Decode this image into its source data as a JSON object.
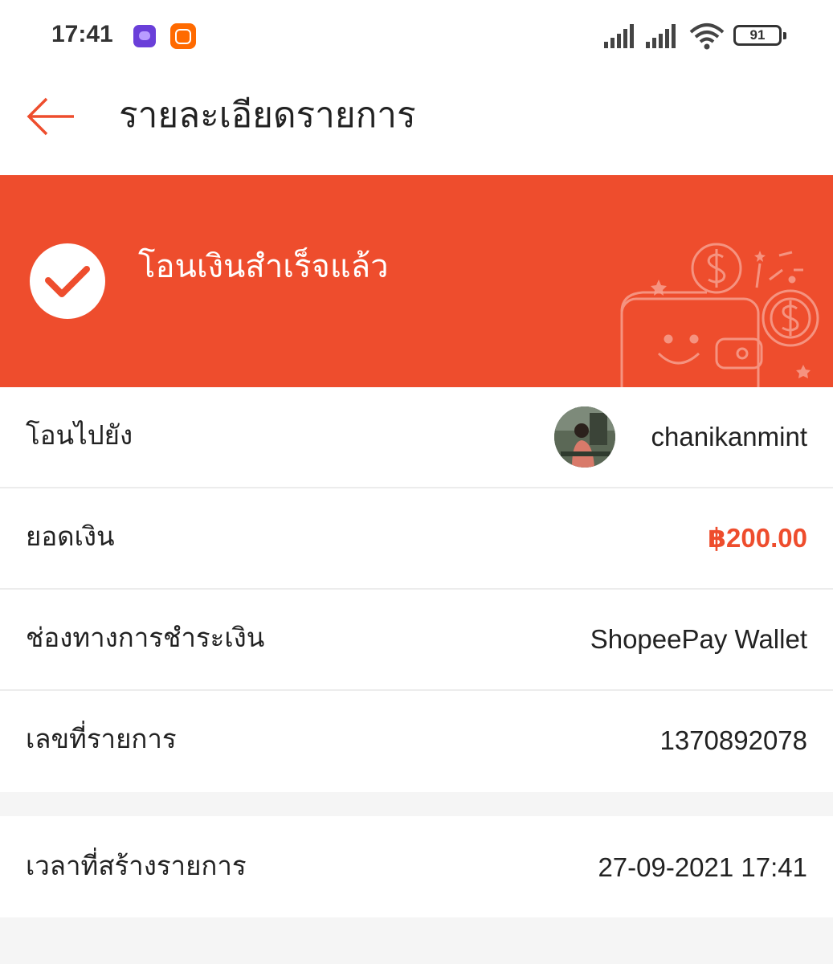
{
  "status_bar": {
    "time": "17:41",
    "battery": "91",
    "icons": [
      "app-notification-icon",
      "mi-app-icon",
      "signal-icon",
      "signal-icon",
      "wifi-icon",
      "battery-icon"
    ]
  },
  "header": {
    "title": "รายละเอียดรายการ",
    "back_icon": "arrow-left-icon"
  },
  "banner": {
    "status_text": "โอนเงินสำเร็จแล้ว",
    "status_icon": "check-circle-icon",
    "illustration": "wallet-coins-illustration",
    "color": "#ee4d2d"
  },
  "details": {
    "recipient_label": "โอนไปยัง",
    "recipient_name": "chanikanmint",
    "amount_label": "ยอดเงิน",
    "amount_value": "฿200.00",
    "payment_method_label": "ช่องทางการชำระเงิน",
    "payment_method_value": "ShopeePay Wallet",
    "transaction_no_label": "เลขที่รายการ",
    "transaction_no_value": "1370892078"
  },
  "created": {
    "label": "เวลาที่สร้างรายการ",
    "value": "27-09-2021 17:41"
  },
  "colors": {
    "accent": "#ee4d2d",
    "background": "#f5f5f5",
    "divider": "#ececec"
  }
}
